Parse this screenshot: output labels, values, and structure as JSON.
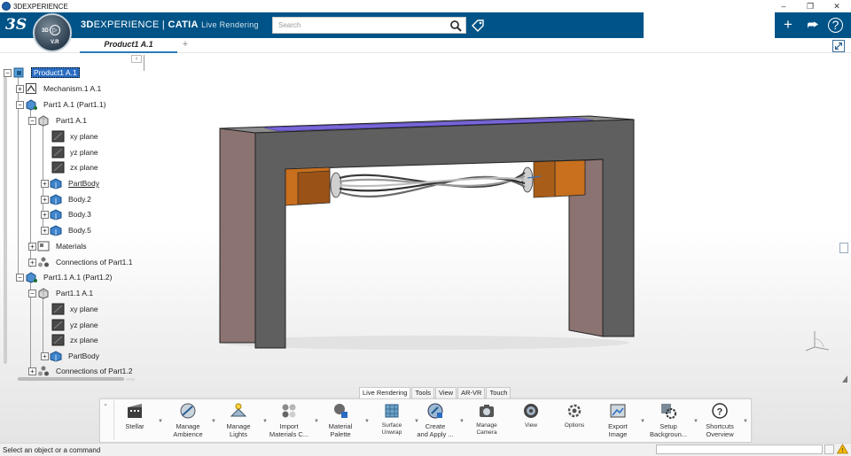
{
  "window": {
    "title": "3DEXPERIENCE",
    "minimize": "–",
    "restore": "❐",
    "close": "✕"
  },
  "header": {
    "logo": "3S",
    "compass": {
      "left": "3D",
      "version": "V.R"
    },
    "brand_bold": "3D",
    "brand_rest": "EXPERIENCE | ",
    "brand_app": "CATIA",
    "brand_module": "Live Rendering",
    "search_placeholder": "Search",
    "add_label": "+",
    "share_label": "⮫",
    "help_label": "?"
  },
  "tabs": {
    "active": "Product1 A.1",
    "add": "+"
  },
  "tree": {
    "collapse_label": "‹",
    "items": [
      {
        "label": "Product1 A.1",
        "toggle": "−",
        "icon": "product-icon",
        "selected": true
      },
      {
        "label": "Mechanism.1 A.1",
        "toggle": "+",
        "icon": "mechanism-icon"
      },
      {
        "label": "Part1 A.1 (Part1.1)",
        "toggle": "−",
        "icon": "part-instance-icon"
      },
      {
        "label": "Part1 A.1",
        "toggle": "−",
        "icon": "part-icon"
      },
      {
        "label": "xy plane",
        "toggle": "",
        "icon": "plane-icon"
      },
      {
        "label": "yz plane",
        "toggle": "",
        "icon": "plane-icon"
      },
      {
        "label": "zx plane",
        "toggle": "",
        "icon": "plane-icon"
      },
      {
        "label": "PartBody",
        "toggle": "+",
        "icon": "body-icon",
        "underline": true
      },
      {
        "label": "Body.2",
        "toggle": "+",
        "icon": "body-icon"
      },
      {
        "label": "Body.3",
        "toggle": "+",
        "icon": "body-icon"
      },
      {
        "label": "Body.5",
        "toggle": "+",
        "icon": "body-icon"
      },
      {
        "label": "Materials",
        "toggle": "+",
        "icon": "materials-icon"
      },
      {
        "label": "Connections of Part1.1",
        "toggle": "+",
        "icon": "connections-icon"
      },
      {
        "label": "Part1.1 A.1 (Part1.2)",
        "toggle": "−",
        "icon": "part-instance-icon"
      },
      {
        "label": "Part1.1 A.1",
        "toggle": "−",
        "icon": "part-icon"
      },
      {
        "label": "xy plane",
        "toggle": "",
        "icon": "plane-icon"
      },
      {
        "label": "yz plane",
        "toggle": "",
        "icon": "plane-icon"
      },
      {
        "label": "zx plane",
        "toggle": "",
        "icon": "plane-icon"
      },
      {
        "label": "PartBody",
        "toggle": "+",
        "icon": "body-icon"
      },
      {
        "label": "Connections of Part1.2",
        "toggle": "+",
        "icon": "connections-icon"
      }
    ]
  },
  "actionbar": {
    "expander": "⌄",
    "tabs": [
      "Live Rendering",
      "Tools",
      "View",
      "AR-VR",
      "Touch"
    ],
    "active_tab": "Live Rendering",
    "commands": [
      {
        "label": "Stellar",
        "icon": "stellar-icon"
      },
      {
        "label": "Manage\nAmbience",
        "icon": "ambience-icon"
      },
      {
        "label": "Manage\nLights",
        "icon": "lights-icon"
      },
      {
        "label": "Import\nMaterials C...",
        "icon": "import-materials-icon"
      },
      {
        "label": "Material\nPalette",
        "icon": "material-palette-icon"
      },
      {
        "label": "Surface\nUnwrap",
        "icon": "surface-unwrap-icon",
        "small": true
      },
      {
        "label": "Create\nand Apply ...",
        "icon": "create-apply-icon"
      },
      {
        "label": "Manage\nCamera",
        "icon": "camera-icon",
        "small": true
      },
      {
        "label": "View",
        "icon": "view-icon",
        "small": true
      },
      {
        "label": "Options",
        "icon": "options-icon",
        "small": true
      },
      {
        "label": "Export\nImage",
        "icon": "export-image-icon"
      },
      {
        "label": "Setup\nBackgroun...",
        "icon": "setup-background-icon"
      },
      {
        "label": "Shortcuts\nOverview",
        "icon": "shortcuts-icon"
      }
    ]
  },
  "status": {
    "message": "Select an object or a command",
    "warning_icon": "warning-icon"
  },
  "colors": {
    "header_bg": "#005386",
    "selection": "#2a6cc1",
    "frame_gray": "#5f5f5f",
    "leg_pink": "#8a7371",
    "top_face": "#7866d8",
    "block_orange": "#c8701e"
  }
}
